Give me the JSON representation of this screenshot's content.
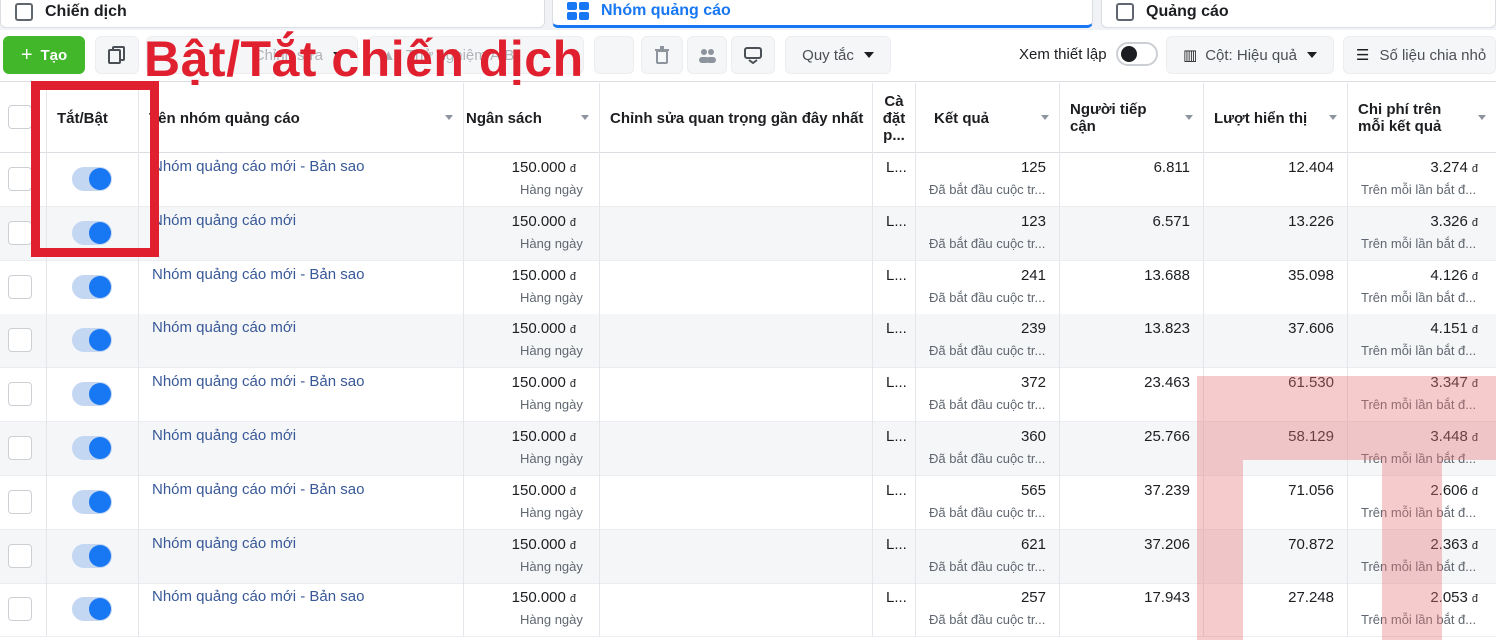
{
  "tabs": [
    {
      "label": "Chiến dịch",
      "icon": "folder-icon"
    },
    {
      "label": "Nhóm quảng cáo",
      "icon": "grid-icon"
    },
    {
      "label": "Quảng cáo",
      "icon": "page-icon"
    }
  ],
  "toolbar": {
    "create_label": "Tạo",
    "edit_label": "Chỉnh sửa",
    "ab_label": "Thử nghiệm A/B",
    "rules_label": "Quy tắc",
    "view_setup_label": "Xem thiết lập",
    "columns_label": "Cột: Hiệu quả",
    "breakdown_label": "Số liệu chia nhỏ"
  },
  "annotation": {
    "title": "Bật/Tắt chiến dịch",
    "color": "#e0202e"
  },
  "columns": {
    "toggle": "Tắt/Bật",
    "name": "Tên nhóm quảng cáo",
    "budget": "Ngân sách",
    "recent_edit": "Chỉnh sửa quan trọng gần đây nhất",
    "setting_1": "Cà",
    "setting_2": "đặt",
    "setting_3": "p...",
    "results": "Kết quả",
    "reach_1": "Người tiếp",
    "reach_2": "cận",
    "impressions": "Lượt hiển thị",
    "cost_1": "Chi phí trên",
    "cost_2": "mỗi kết quả"
  },
  "rows": [
    {
      "name": "Nhóm quảng cáo mới - Bản sao",
      "budget": "150.000",
      "currency": "đ",
      "budget_period": "Hàng ngày",
      "setting": "L...",
      "results": "125",
      "results_note": "Đã bắt đầu cuộc tr...",
      "reach": "6.811",
      "impressions": "12.404",
      "cost": "3.274",
      "cost_note": "Trên mỗi lần bắt đ...",
      "on": true
    },
    {
      "name": "Nhóm quảng cáo mới",
      "budget": "150.000",
      "currency": "đ",
      "budget_period": "Hàng ngày",
      "setting": "L...",
      "results": "123",
      "results_note": "Đã bắt đầu cuộc tr...",
      "reach": "6.571",
      "impressions": "13.226",
      "cost": "3.326",
      "cost_note": "Trên mỗi lần bắt đ...",
      "on": true
    },
    {
      "name": "Nhóm quảng cáo mới - Bản sao",
      "budget": "150.000",
      "currency": "đ",
      "budget_period": "Hàng ngày",
      "setting": "L...",
      "results": "241",
      "results_note": "Đã bắt đầu cuộc tr...",
      "reach": "13.688",
      "impressions": "35.098",
      "cost": "4.126",
      "cost_note": "Trên mỗi lần bắt đ...",
      "on": true
    },
    {
      "name": "Nhóm quảng cáo mới",
      "budget": "150.000",
      "currency": "đ",
      "budget_period": "Hàng ngày",
      "setting": "L...",
      "results": "239",
      "results_note": "Đã bắt đầu cuộc tr...",
      "reach": "13.823",
      "impressions": "37.606",
      "cost": "4.151",
      "cost_note": "Trên mỗi lần bắt đ...",
      "on": true
    },
    {
      "name": "Nhóm quảng cáo mới - Bản sao",
      "budget": "150.000",
      "currency": "đ",
      "budget_period": "Hàng ngày",
      "setting": "L...",
      "results": "372",
      "results_note": "Đã bắt đầu cuộc tr...",
      "reach": "23.463",
      "impressions": "61.530",
      "cost": "3.347",
      "cost_note": "Trên mỗi lần bắt đ...",
      "on": true
    },
    {
      "name": "Nhóm quảng cáo mới",
      "budget": "150.000",
      "currency": "đ",
      "budget_period": "Hàng ngày",
      "setting": "L...",
      "results": "360",
      "results_note": "Đã bắt đầu cuộc tr...",
      "reach": "25.766",
      "impressions": "58.129",
      "cost": "3.448",
      "cost_note": "Trên mỗi lần bắt đ...",
      "on": true
    },
    {
      "name": "Nhóm quảng cáo mới - Bản sao",
      "budget": "150.000",
      "currency": "đ",
      "budget_period": "Hàng ngày",
      "setting": "L...",
      "results": "565",
      "results_note": "Đã bắt đầu cuộc tr...",
      "reach": "37.239",
      "impressions": "71.056",
      "cost": "2.606",
      "cost_note": "Trên mỗi lần bắt đ...",
      "on": true
    },
    {
      "name": "Nhóm quảng cáo mới",
      "budget": "150.000",
      "currency": "đ",
      "budget_period": "Hàng ngày",
      "setting": "L...",
      "results": "621",
      "results_note": "Đã bắt đầu cuộc tr...",
      "reach": "37.206",
      "impressions": "70.872",
      "cost": "2.363",
      "cost_note": "Trên mỗi lần bắt đ...",
      "on": true
    },
    {
      "name": "Nhóm quảng cáo mới - Bản sao",
      "budget": "150.000",
      "currency": "đ",
      "budget_period": "Hàng ngày",
      "setting": "L...",
      "results": "257",
      "results_note": "Đã bắt đầu cuộc tr...",
      "reach": "17.943",
      "impressions": "27.248",
      "cost": "2.053",
      "cost_note": "Trên mỗi lần bắt đ...",
      "on": true
    }
  ]
}
